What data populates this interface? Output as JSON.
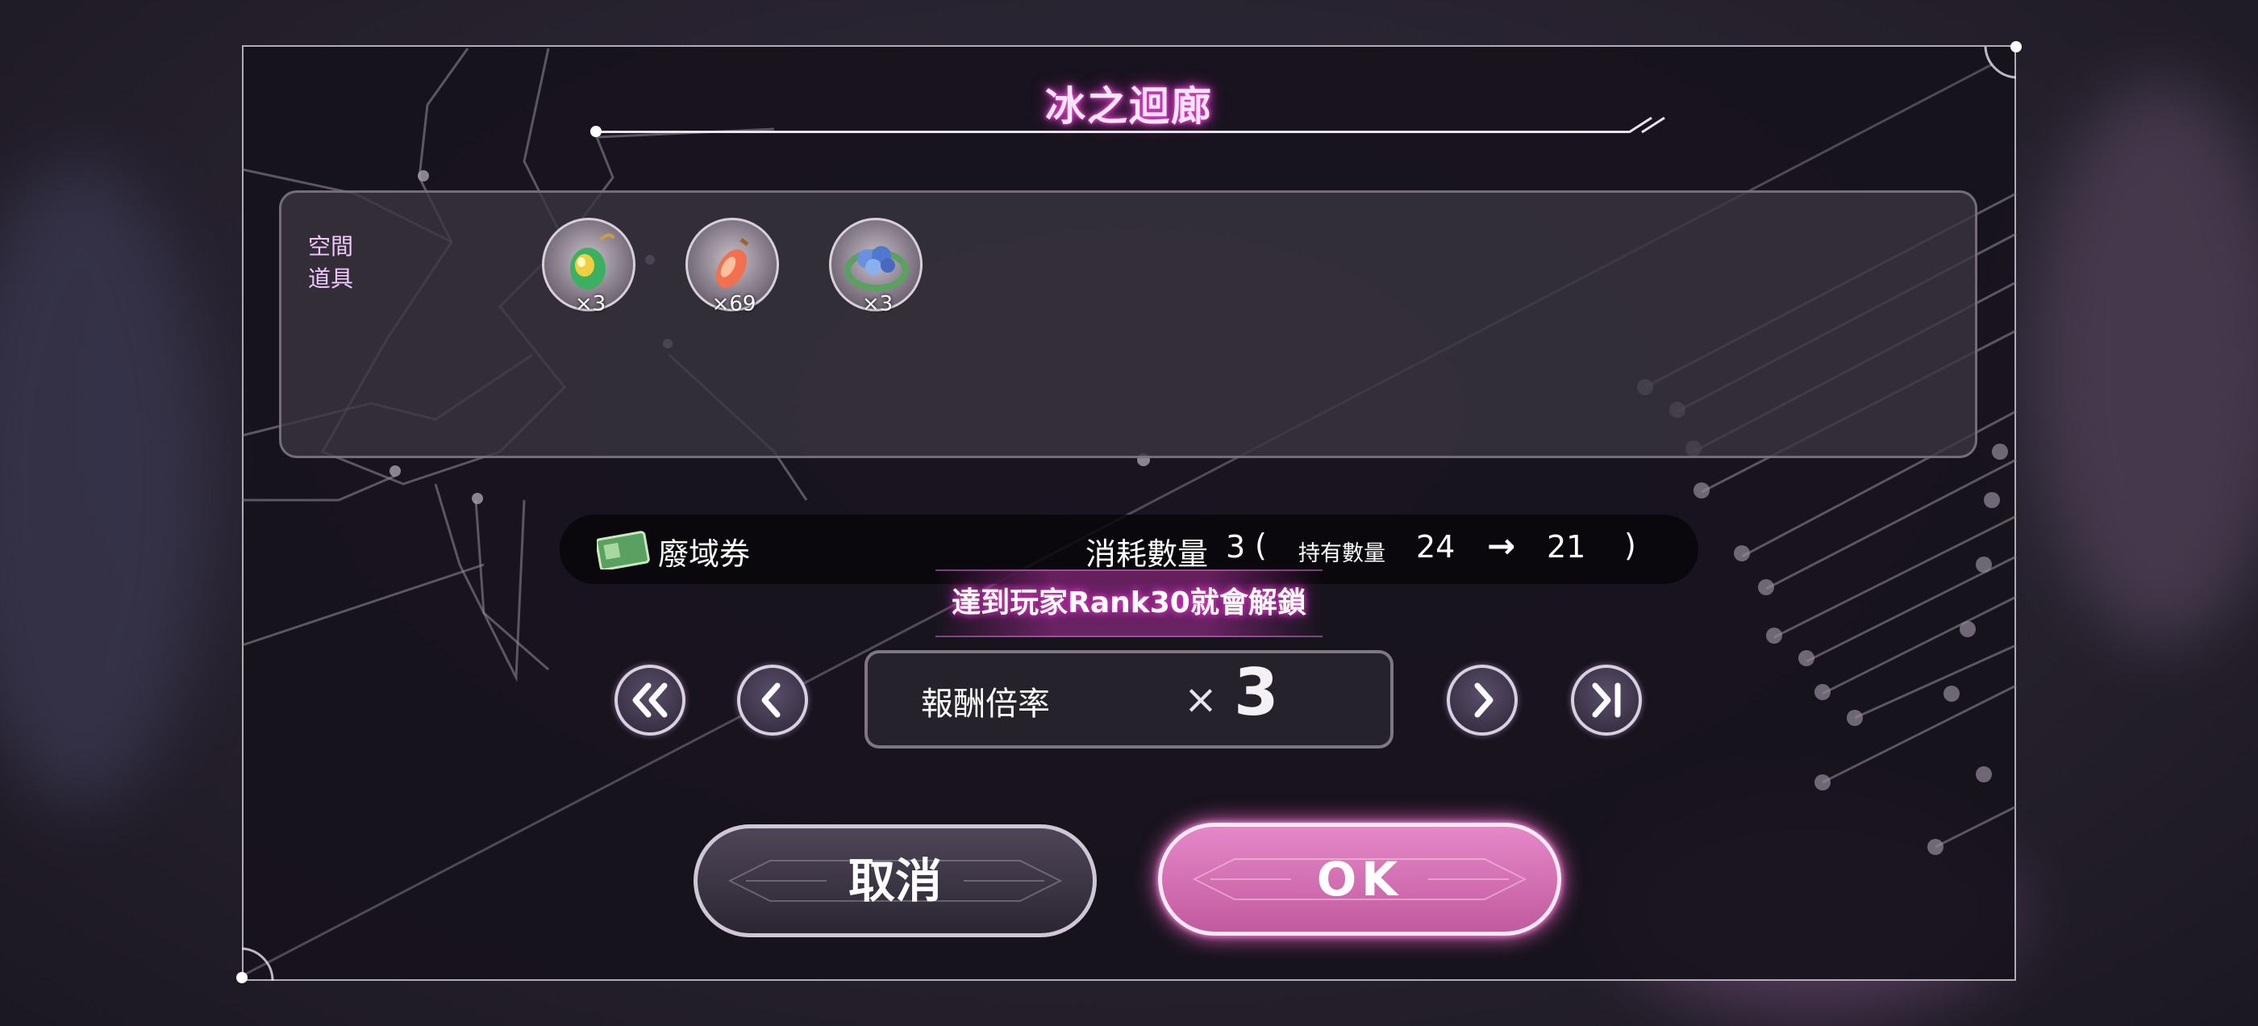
{
  "dialog": {
    "title": "冰之迴廊"
  },
  "rewards": {
    "label": "空間道具",
    "label_line1": "空間",
    "label_line2": "道具",
    "items": [
      {
        "icon": "green-gem-pendant-icon",
        "count": "×3"
      },
      {
        "icon": "orange-crystal-icon",
        "count": "×69"
      },
      {
        "icon": "blue-flower-ring-icon",
        "count": "×3"
      }
    ]
  },
  "cost": {
    "item_name": "廢域券",
    "consume_label": "消耗數量",
    "consume_value": "3",
    "open_paren": "(",
    "owned_label": "持有數量",
    "owned_before": "24",
    "arrow": "→",
    "owned_after": "21",
    "close_paren": ")"
  },
  "unlock_notice": "達到玩家Rank30就會解鎖",
  "multiplier": {
    "label": "報酬倍率",
    "times": "×",
    "value": "3"
  },
  "buttons": {
    "cancel": "取消",
    "ok": "OK"
  },
  "colors": {
    "title_glow": "#e040c8",
    "ok_button": "#d470b4",
    "label_pink": "#f0c8ff"
  }
}
